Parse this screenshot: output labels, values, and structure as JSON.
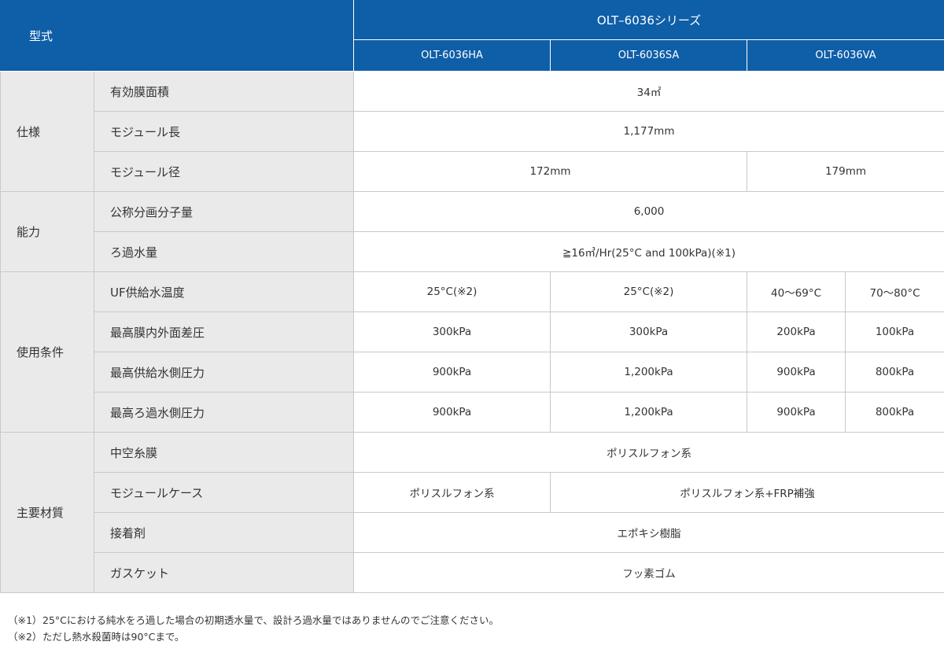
{
  "header": {
    "model_label": "型式",
    "series": "OLT–6036シリーズ",
    "models": [
      "OLT-6036HA",
      "OLT-6036SA",
      "OLT-6036VA"
    ]
  },
  "groups": {
    "spec": "仕様",
    "capacity": "能力",
    "conditions": "使用条件",
    "materials": "主要材質"
  },
  "rows": {
    "area": {
      "label": "有効膜面積",
      "value": "34㎡"
    },
    "length": {
      "label": "モジュール長",
      "value": "1,177mm"
    },
    "diameter": {
      "label": "モジュール径",
      "v1": "172mm",
      "v2": "179mm"
    },
    "mwco": {
      "label": "公称分画分子量",
      "value": "6,000"
    },
    "flux": {
      "label": "ろ過水量",
      "value": "≧16㎥/Hr(25°C and 100kPa)(※1)"
    },
    "temp": {
      "label": "UF供給水温度",
      "values": [
        "25°C(※2)",
        "25°C(※2)",
        "40〜69°C",
        "70〜80°C"
      ]
    },
    "tmp": {
      "label": "最高膜内外面差圧",
      "values": [
        "300kPa",
        "300kPa",
        "200kPa",
        "100kPa"
      ]
    },
    "feed": {
      "label": "最高供給水側圧力",
      "values": [
        "900kPa",
        "1,200kPa",
        "900kPa",
        "800kPa"
      ]
    },
    "filtrate": {
      "label": "最高ろ過水側圧力",
      "values": [
        "900kPa",
        "1,200kPa",
        "900kPa",
        "800kPa"
      ]
    },
    "fiber": {
      "label": "中空糸膜",
      "value": "ポリスルフォン系"
    },
    "case": {
      "label": "モジュールケース",
      "v1": "ポリスルフォン系",
      "v2": "ポリスルフォン系+FRP補強"
    },
    "adhesive": {
      "label": "接着剤",
      "value": "エポキシ樹脂"
    },
    "gasket": {
      "label": "ガスケット",
      "value": "フッ素ゴム"
    }
  },
  "notes": [
    {
      "mark": "（※1）",
      "text": "25°Cにおける純水をろ過した場合の初期透水量で、設計ろ過水量ではありませんのでご注意ください。"
    },
    {
      "mark": "（※2）",
      "text": "ただし熱水殺菌時は90°Cまで。"
    }
  ],
  "colors": {
    "header_bg": "#0f5ea8",
    "label_bg": "#eaeaea",
    "border": "#c9c9c9"
  }
}
